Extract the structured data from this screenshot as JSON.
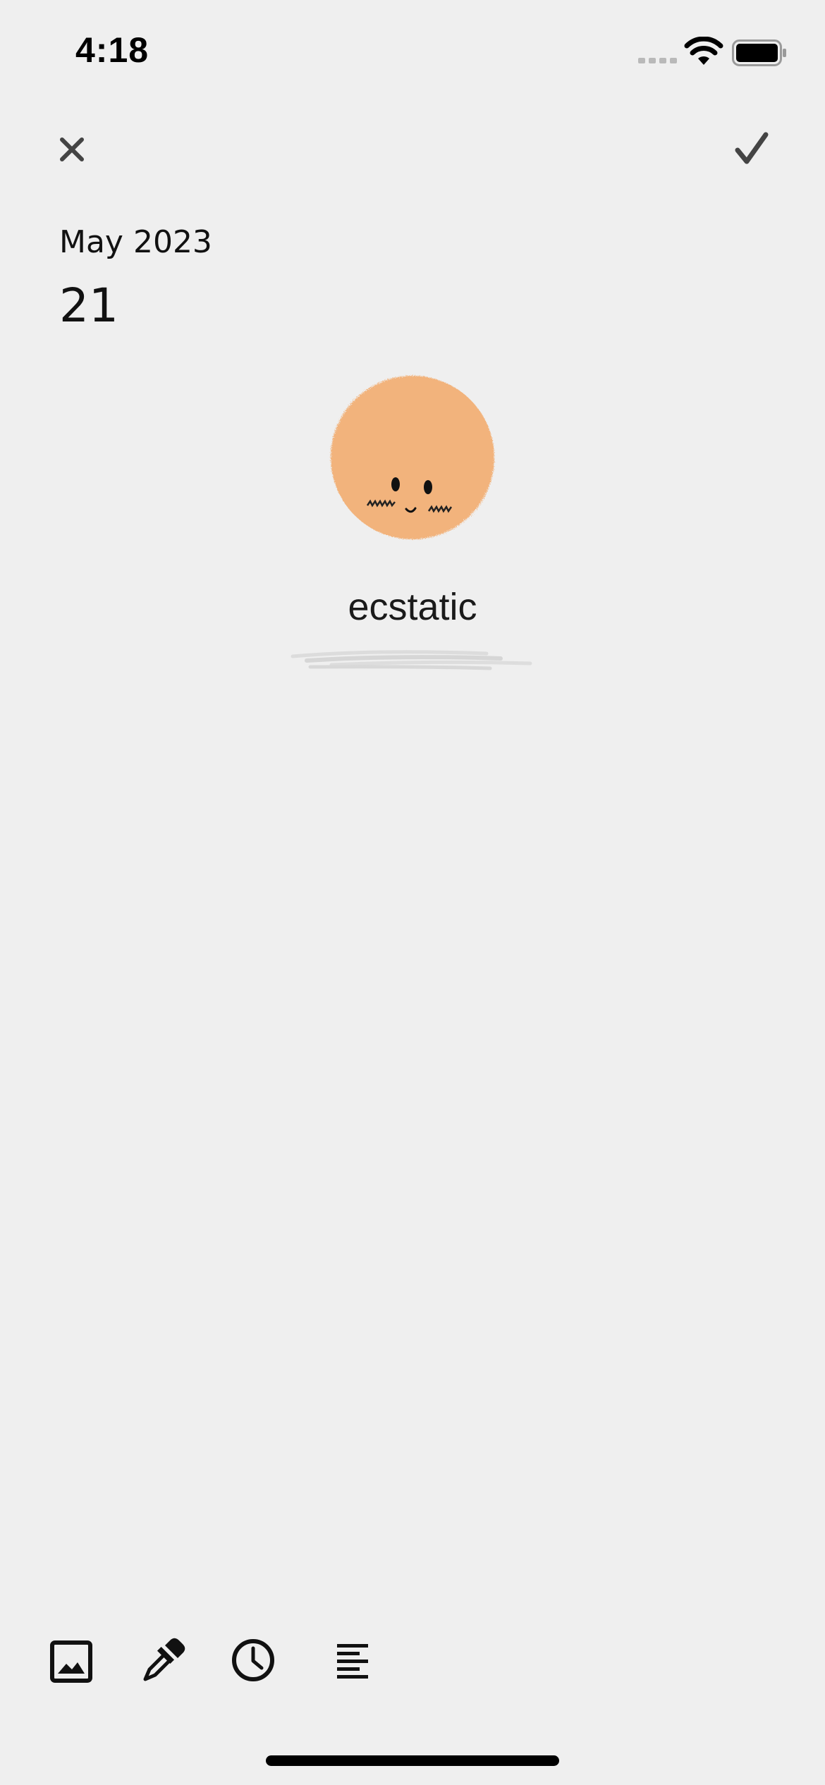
{
  "status_bar": {
    "time": "4:18"
  },
  "header": {
    "close_icon": "close-icon",
    "confirm_icon": "checkmark-icon"
  },
  "entry": {
    "month_year": "May 2023",
    "day": "21"
  },
  "mood": {
    "label": "ecstatic",
    "color": "#f2b37b"
  },
  "toolbar": {
    "items": [
      "image-icon",
      "color-picker-icon",
      "clock-icon",
      "text-align-icon"
    ]
  }
}
